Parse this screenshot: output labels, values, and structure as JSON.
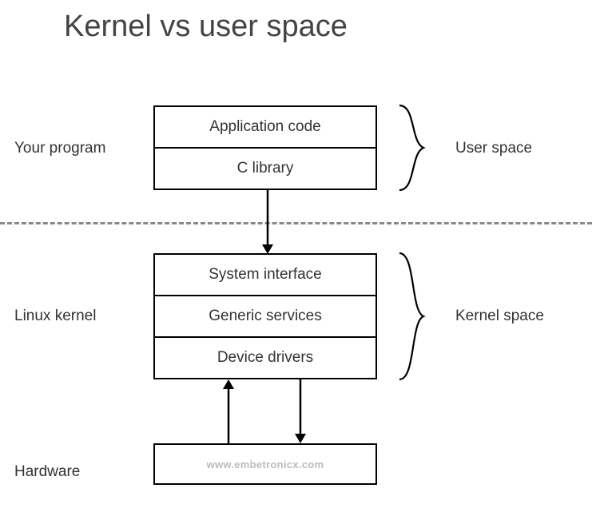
{
  "title": "Kernel vs user space",
  "left_labels": {
    "your_program": "Your program",
    "linux_kernel": "Linux kernel",
    "hardware": "Hardware"
  },
  "right_labels": {
    "user_space": "User space",
    "kernel_space": "Kernel space"
  },
  "boxes": {
    "application_code": "Application code",
    "c_library": "C library",
    "system_interface": "System interface",
    "generic_services": "Generic services",
    "device_drivers": "Device drivers",
    "hardware_watermark": "www.embetronicx.com"
  }
}
